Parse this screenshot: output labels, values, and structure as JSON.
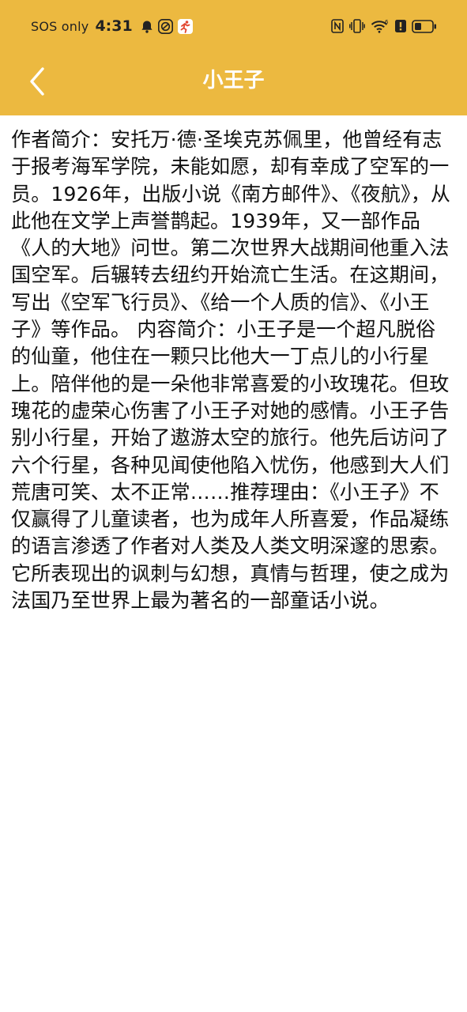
{
  "status_bar": {
    "carrier": "SOS only",
    "time": "4:31",
    "icons": [
      "bell-icon",
      "app-notification-icon",
      "fitness-app-icon",
      "nfc-icon",
      "vibrate-icon",
      "wifi-icon",
      "alert-icon",
      "battery-icon"
    ]
  },
  "toolbar": {
    "title": "小王子",
    "back_icon": "chevron-left-icon"
  },
  "content": {
    "text": "作者简介：安托万·德·圣埃克苏佩里，他曾经有志于报考海军学院，未能如愿，却有幸成了空军的一员。1926年，出版小说《南方邮件》、《夜航》，从此他在文学上声誉鹊起。1939年，又一部作品《人的大地》问世。第二次世界大战期间他重入法国空军。后辗转去纽约开始流亡生活。在这期间，写出《空军飞行员》、《给一个人质的信》、《小王子》等作品。 内容简介：小王子是一个超凡脱俗的仙童，他住在一颗只比他大一丁点儿的小行星上。陪伴他的是一朵他非常喜爱的小玫瑰花。但玫瑰花的虚荣心伤害了小王子对她的感情。小王子告别小行星，开始了遨游太空的旅行。他先后访问了六个行星，各种见闻使他陷入忧伤，他感到大人们荒唐可笑、太不正常……推荐理由：《小王子》不仅赢得了儿童读者，也为成年人所喜爱，作品凝练的语言渗透了作者对人类及人类文明深邃的思索。它所表现出的讽刺与幻想，真情与哲理，使之成为法国乃至世界上最为著名的一部童话小说。"
  },
  "colors": {
    "header_bg": "#ecb940",
    "title_text": "#ffffff",
    "body_text": "#111111",
    "background": "#ffffff"
  }
}
